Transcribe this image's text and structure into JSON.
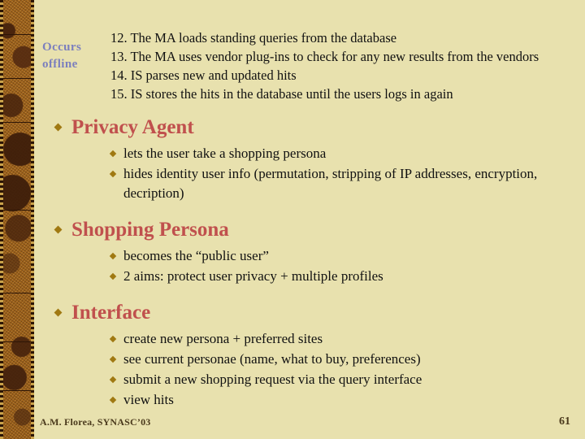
{
  "slide": {
    "background_color": "#E8E1AE",
    "heading_color": "#C0504D",
    "bullet_color": "#A07912",
    "side_label_color": "#7B7FBE",
    "footer_color": "#4B3A1D",
    "sidebar_color": "#A4661A"
  },
  "side_label": {
    "line1": "Occurs",
    "line2": "offline"
  },
  "numbered_list": [
    "12. The MA loads standing queries from the database",
    "13. The MA uses vendor plug-ins to check for any new results from the vendors",
    "14. IS parses new and updated hits",
    "15. IS stores the hits in the database until the users logs in again"
  ],
  "sections": [
    {
      "title": "Privacy Agent",
      "items": [
        "lets the user take a shopping persona",
        "hides identity user info (permutation, stripping of IP addresses, encryption, decription)"
      ]
    },
    {
      "title": "Shopping Persona",
      "items": [
        "becomes the “public user”",
        "2 aims: protect user privacy + multiple profiles"
      ]
    },
    {
      "title": "Interface",
      "items": [
        "create new persona + preferred sites",
        "see current personae (name, what to buy, preferences)",
        "submit a new shopping request via the query interface",
        "view hits"
      ]
    }
  ],
  "footer": {
    "credit": "A.M. Florea, SYNASC’03",
    "page_number": "61"
  }
}
